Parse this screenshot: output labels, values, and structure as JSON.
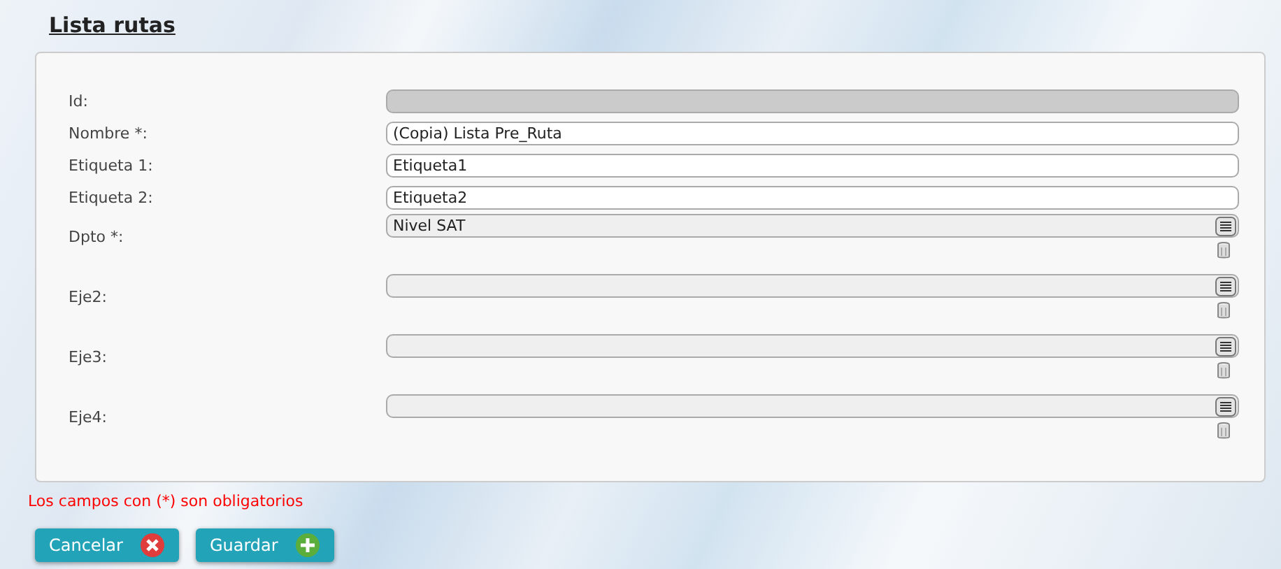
{
  "title": "Lista rutas",
  "fields": [
    {
      "kind": "text",
      "label": "Id:",
      "disabled": true
    },
    {
      "kind": "text",
      "label": "Nombre *:",
      "value": "(Copia) Lista Pre_Ruta",
      "disabled": false
    },
    {
      "kind": "text",
      "label": "Etiqueta 1:",
      "value": "Etiqueta1",
      "disabled": false
    },
    {
      "kind": "text",
      "label": "Etiqueta 2:",
      "value": "Etiqueta2",
      "disabled": false
    },
    {
      "kind": "lookup",
      "label": "Dpto *:",
      "value": "Nivel SAT"
    },
    {
      "kind": "lookup",
      "label": "Eje2:"
    },
    {
      "kind": "lookup",
      "label": "Eje3:"
    },
    {
      "kind": "lookup",
      "label": "Eje4:"
    }
  ],
  "note": "Los campos con (*) son obligatorios",
  "buttons": [
    {
      "kind": "cancel",
      "label": "Cancelar"
    },
    {
      "kind": "save",
      "label": "Guardar"
    }
  ]
}
